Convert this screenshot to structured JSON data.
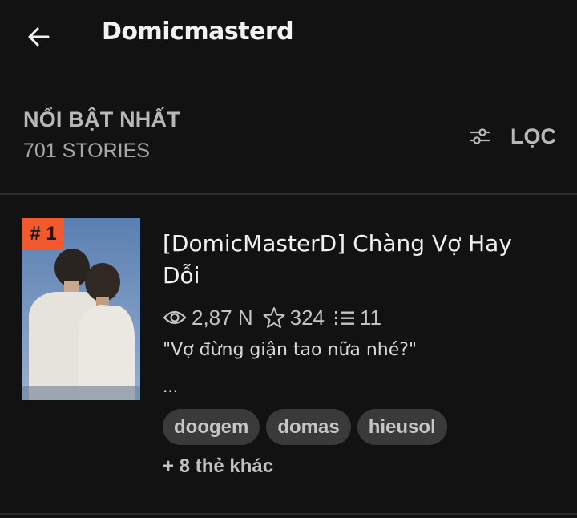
{
  "app_bar": {
    "title": "Domicmasterd",
    "back_icon": "arrow-left-icon"
  },
  "section": {
    "title": "NỔI BẬT NHẤT",
    "count": "701 STORIES",
    "filter_label": "LỌC",
    "filter_icon": "sliders-icon"
  },
  "story": {
    "rank": "# 1",
    "title": "[DomicMasterD] Chàng Vợ Hay Dỗi",
    "reads": "2,87 N",
    "votes": "324",
    "parts": "11",
    "description": "\"Vợ đừng giận tao nữa nhé?\"",
    "ellipsis": "...",
    "tags": [
      "doogem",
      "domas",
      "hieusol"
    ],
    "more_tags": "+ 8 thẻ khác"
  },
  "colors": {
    "background": "#121212",
    "rank_badge": "#f25a2e",
    "tag_background": "#3a3a3a",
    "divider": "#2c2c2c"
  }
}
